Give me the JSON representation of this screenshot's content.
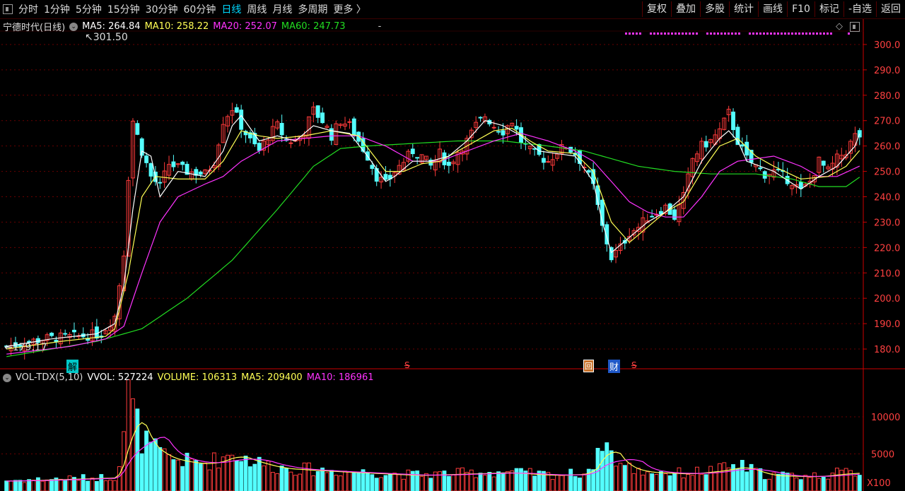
{
  "toolbar": {
    "left": [
      "分时",
      "1分钟",
      "5分钟",
      "15分钟",
      "30分钟",
      "60分钟",
      "日线",
      "周线",
      "月线",
      "多周期",
      "更多 〉"
    ],
    "active": "日线",
    "right": [
      "复权",
      "叠加",
      "多股",
      "统计",
      "画线",
      "F10",
      "标记",
      "-自选",
      "返回"
    ]
  },
  "main_legend": {
    "stock": "宁德时代(日线)",
    "ma5_label": "MA5:",
    "ma5": "264.84",
    "ma10_label": "MA10:",
    "ma10": "258.22",
    "ma20_label": "MA20:",
    "ma20": "252.07",
    "ma60_label": "MA60:",
    "ma60": "247.73",
    "tail": "-"
  },
  "vol_legend": {
    "name": "VOL-TDX(5,10)",
    "vvol_label": "VVOL:",
    "vvol": "527224",
    "volume_label": "VOLUME:",
    "volume": "106313",
    "ma5_label": "MA5:",
    "ma5": "209400",
    "ma10_label": "MA10:",
    "ma10": "186961"
  },
  "annotations": {
    "high": "301.50",
    "low": "179.17",
    "unlock": "解",
    "s_marker": "S",
    "report": "财",
    "box": "回"
  },
  "colors": {
    "up": "#ff3b3b",
    "down": "#54ffff",
    "ma5": "#ffffff",
    "ma10": "#ffff55",
    "ma20": "#ff33ff",
    "ma60": "#22dd22",
    "axis": "#cc0000",
    "grid": "#6a0000"
  },
  "chart_data": {
    "type": "candlestick",
    "price_axis": {
      "ylim": [
        175,
        305
      ],
      "ticks": [
        180.0,
        190.0,
        200.0,
        210.0,
        220.0,
        230.0,
        240.0,
        250.0,
        260.0,
        270.0,
        280.0,
        290.0,
        300.0
      ]
    },
    "volume_axis": {
      "ylim": [
        0,
        14000
      ],
      "ticks": [
        5000,
        10000
      ],
      "unit": "X100"
    },
    "keypoints": {
      "close": [
        [
          0,
          181
        ],
        [
          8,
          184
        ],
        [
          16,
          185
        ],
        [
          21,
          186
        ],
        [
          24,
          193
        ],
        [
          26,
          218
        ],
        [
          27,
          248
        ],
        [
          28,
          270
        ],
        [
          30,
          258
        ],
        [
          32,
          248
        ],
        [
          34,
          244
        ],
        [
          36,
          253
        ],
        [
          40,
          250
        ],
        [
          44,
          249
        ],
        [
          46,
          254
        ],
        [
          48,
          270
        ],
        [
          50,
          275
        ],
        [
          52,
          268
        ],
        [
          54,
          262
        ],
        [
          56,
          258
        ],
        [
          58,
          264
        ],
        [
          60,
          268
        ],
        [
          62,
          262
        ],
        [
          64,
          262
        ],
        [
          66,
          266
        ],
        [
          68,
          274
        ],
        [
          70,
          270
        ],
        [
          72,
          264
        ],
        [
          74,
          270
        ],
        [
          76,
          268
        ],
        [
          78,
          262
        ],
        [
          80,
          256
        ],
        [
          82,
          248
        ],
        [
          84,
          245
        ],
        [
          86,
          250
        ],
        [
          88,
          254
        ],
        [
          90,
          258
        ],
        [
          92,
          256
        ],
        [
          94,
          252
        ],
        [
          96,
          257
        ],
        [
          98,
          252
        ],
        [
          100,
          258
        ],
        [
          102,
          262
        ],
        [
          104,
          268
        ],
        [
          106,
          272
        ],
        [
          108,
          268
        ],
        [
          110,
          266
        ],
        [
          112,
          270
        ],
        [
          114,
          262
        ],
        [
          116,
          258
        ],
        [
          118,
          256
        ],
        [
          120,
          254
        ],
        [
          122,
          258
        ],
        [
          124,
          260
        ],
        [
          126,
          257
        ],
        [
          128,
          252
        ],
        [
          130,
          244
        ],
        [
          132,
          228
        ],
        [
          134,
          216
        ],
        [
          136,
          220
        ],
        [
          138,
          226
        ],
        [
          140,
          228
        ],
        [
          142,
          232
        ],
        [
          144,
          234
        ],
        [
          146,
          236
        ],
        [
          148,
          232
        ],
        [
          150,
          240
        ],
        [
          152,
          255
        ],
        [
          154,
          260
        ],
        [
          156,
          262
        ],
        [
          158,
          266
        ],
        [
          160,
          273
        ],
        [
          162,
          262
        ],
        [
          164,
          255
        ],
        [
          166,
          252
        ],
        [
          168,
          249
        ],
        [
          170,
          250
        ],
        [
          172,
          248
        ],
        [
          174,
          246
        ],
        [
          176,
          242
        ],
        [
          178,
          246
        ],
        [
          180,
          254
        ],
        [
          182,
          250
        ],
        [
          184,
          255
        ],
        [
          186,
          258
        ],
        [
          188,
          264
        ],
        [
          189,
          264
        ]
      ],
      "ma5": [
        [
          0,
          181
        ],
        [
          10,
          184
        ],
        [
          20,
          186
        ],
        [
          24,
          190
        ],
        [
          26,
          205
        ],
        [
          28,
          235
        ],
        [
          30,
          258
        ],
        [
          32,
          256
        ],
        [
          34,
          240
        ],
        [
          38,
          250
        ],
        [
          44,
          248
        ],
        [
          48,
          258
        ],
        [
          50,
          268
        ],
        [
          52,
          272
        ],
        [
          56,
          262
        ],
        [
          60,
          264
        ],
        [
          64,
          262
        ],
        [
          68,
          268
        ],
        [
          72,
          266
        ],
        [
          76,
          265
        ],
        [
          80,
          256
        ],
        [
          84,
          246
        ],
        [
          86,
          248
        ],
        [
          90,
          254
        ],
        [
          94,
          254
        ],
        [
          98,
          256
        ],
        [
          102,
          262
        ],
        [
          106,
          270
        ],
        [
          110,
          268
        ],
        [
          114,
          264
        ],
        [
          118,
          258
        ],
        [
          122,
          257
        ],
        [
          126,
          256
        ],
        [
          130,
          246
        ],
        [
          132,
          230
        ],
        [
          134,
          218
        ],
        [
          138,
          224
        ],
        [
          142,
          230
        ],
        [
          146,
          234
        ],
        [
          150,
          240
        ],
        [
          154,
          254
        ],
        [
          158,
          263
        ],
        [
          160,
          266
        ],
        [
          162,
          262
        ],
        [
          164,
          254
        ],
        [
          170,
          250
        ],
        [
          176,
          243
        ],
        [
          180,
          248
        ],
        [
          184,
          252
        ],
        [
          188,
          260
        ],
        [
          189,
          264.84
        ]
      ],
      "ma10": [
        [
          0,
          180
        ],
        [
          12,
          183
        ],
        [
          22,
          185
        ],
        [
          24,
          188
        ],
        [
          27,
          210
        ],
        [
          30,
          240
        ],
        [
          33,
          248
        ],
        [
          38,
          247
        ],
        [
          44,
          247
        ],
        [
          48,
          254
        ],
        [
          52,
          266
        ],
        [
          56,
          264
        ],
        [
          60,
          263
        ],
        [
          66,
          264
        ],
        [
          72,
          266
        ],
        [
          78,
          264
        ],
        [
          84,
          250
        ],
        [
          88,
          250
        ],
        [
          92,
          253
        ],
        [
          96,
          254
        ],
        [
          100,
          258
        ],
        [
          104,
          262
        ],
        [
          108,
          266
        ],
        [
          112,
          267
        ],
        [
          116,
          262
        ],
        [
          120,
          258
        ],
        [
          126,
          257
        ],
        [
          130,
          250
        ],
        [
          134,
          230
        ],
        [
          138,
          222
        ],
        [
          142,
          228
        ],
        [
          146,
          234
        ],
        [
          150,
          238
        ],
        [
          154,
          250
        ],
        [
          158,
          260
        ],
        [
          162,
          263
        ],
        [
          166,
          256
        ],
        [
          170,
          252
        ],
        [
          176,
          247
        ],
        [
          182,
          248
        ],
        [
          186,
          252
        ],
        [
          189,
          258.22
        ]
      ],
      "ma20": [
        [
          0,
          178
        ],
        [
          14,
          181
        ],
        [
          22,
          184
        ],
        [
          26,
          189
        ],
        [
          30,
          210
        ],
        [
          34,
          230
        ],
        [
          38,
          240
        ],
        [
          44,
          245
        ],
        [
          48,
          248
        ],
        [
          52,
          254
        ],
        [
          56,
          258
        ],
        [
          60,
          262
        ],
        [
          66,
          263
        ],
        [
          72,
          264
        ],
        [
          78,
          264
        ],
        [
          84,
          260
        ],
        [
          90,
          254
        ],
        [
          96,
          254
        ],
        [
          102,
          258
        ],
        [
          108,
          262
        ],
        [
          114,
          265
        ],
        [
          120,
          262
        ],
        [
          126,
          258
        ],
        [
          130,
          254
        ],
        [
          134,
          246
        ],
        [
          138,
          238
        ],
        [
          142,
          234
        ],
        [
          146,
          232
        ],
        [
          150,
          232
        ],
        [
          154,
          240
        ],
        [
          158,
          250
        ],
        [
          162,
          254
        ],
        [
          166,
          255
        ],
        [
          170,
          256
        ],
        [
          176,
          252
        ],
        [
          180,
          248
        ],
        [
          184,
          248
        ],
        [
          189,
          252.07
        ]
      ],
      "ma60": [
        [
          0,
          177
        ],
        [
          10,
          180
        ],
        [
          20,
          183
        ],
        [
          30,
          188
        ],
        [
          40,
          200
        ],
        [
          50,
          215
        ],
        [
          60,
          235
        ],
        [
          68,
          252
        ],
        [
          74,
          259
        ],
        [
          80,
          260
        ],
        [
          90,
          261
        ],
        [
          100,
          262
        ],
        [
          110,
          262
        ],
        [
          120,
          260
        ],
        [
          128,
          258
        ],
        [
          134,
          255
        ],
        [
          140,
          252
        ],
        [
          148,
          250
        ],
        [
          156,
          249
        ],
        [
          166,
          249
        ],
        [
          174,
          247
        ],
        [
          180,
          244
        ],
        [
          186,
          244
        ],
        [
          189,
          247.73
        ]
      ],
      "volume": [
        [
          0,
          1400
        ],
        [
          20,
          1800
        ],
        [
          24,
          1900
        ],
        [
          25,
          4200
        ],
        [
          26,
          8500
        ],
        [
          27,
          13000
        ],
        [
          28,
          11000
        ],
        [
          29,
          9000
        ],
        [
          30,
          7000
        ],
        [
          32,
          6000
        ],
        [
          34,
          5000
        ],
        [
          36,
          4500
        ],
        [
          40,
          4000
        ],
        [
          44,
          3800
        ],
        [
          48,
          4500
        ],
        [
          50,
          5200
        ],
        [
          52,
          4600
        ],
        [
          56,
          3800
        ],
        [
          60,
          3200
        ],
        [
          70,
          2800
        ],
        [
          80,
          2500
        ],
        [
          90,
          2200
        ],
        [
          100,
          2400
        ],
        [
          110,
          2600
        ],
        [
          120,
          2200
        ],
        [
          128,
          2400
        ],
        [
          131,
          4500
        ],
        [
          132,
          7500
        ],
        [
          134,
          5000
        ],
        [
          136,
          3600
        ],
        [
          140,
          2700
        ],
        [
          150,
          2400
        ],
        [
          158,
          2900
        ],
        [
          162,
          3500
        ],
        [
          168,
          2200
        ],
        [
          178,
          2000
        ],
        [
          184,
          2400
        ],
        [
          189,
          2600
        ]
      ]
    }
  }
}
